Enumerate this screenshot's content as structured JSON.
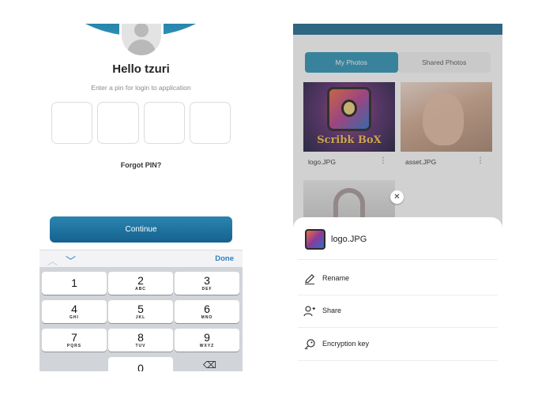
{
  "login_screen": {
    "greeting": "Hello tzuri",
    "subtitle": "Enter a pin for login to application",
    "pin_boxes": 4,
    "forgot_label": "Forgot PIN?",
    "continue_label": "Continue",
    "keyboard": {
      "done_label": "Done",
      "keys": [
        {
          "num": "1",
          "letters": ""
        },
        {
          "num": "2",
          "letters": "ABC"
        },
        {
          "num": "3",
          "letters": "DEF"
        },
        {
          "num": "4",
          "letters": "GHI"
        },
        {
          "num": "5",
          "letters": "JKL"
        },
        {
          "num": "6",
          "letters": "MNO"
        },
        {
          "num": "7",
          "letters": "PQRS"
        },
        {
          "num": "8",
          "letters": "TUV"
        },
        {
          "num": "9",
          "letters": "WXYZ"
        },
        {
          "num": "0",
          "letters": ""
        }
      ],
      "backspace_icon": "backspace-icon"
    }
  },
  "photos_screen": {
    "tabs": [
      {
        "label": "My Photos",
        "active": true
      },
      {
        "label": "Shared Photos",
        "active": false
      }
    ],
    "tiles": [
      {
        "name": "logo.JPG",
        "logo_text": "Scribk BoX"
      },
      {
        "name": "asset.JPG"
      }
    ],
    "sheet": {
      "file_name": "logo.JPG",
      "options": [
        {
          "label": "Rename",
          "icon": "pencil-icon"
        },
        {
          "label": "Share",
          "icon": "add-person-icon"
        },
        {
          "label": "Encryption key",
          "icon": "key-icon"
        }
      ]
    },
    "colors": {
      "accent": "#2b93b4",
      "header": "#1c6c92"
    }
  }
}
